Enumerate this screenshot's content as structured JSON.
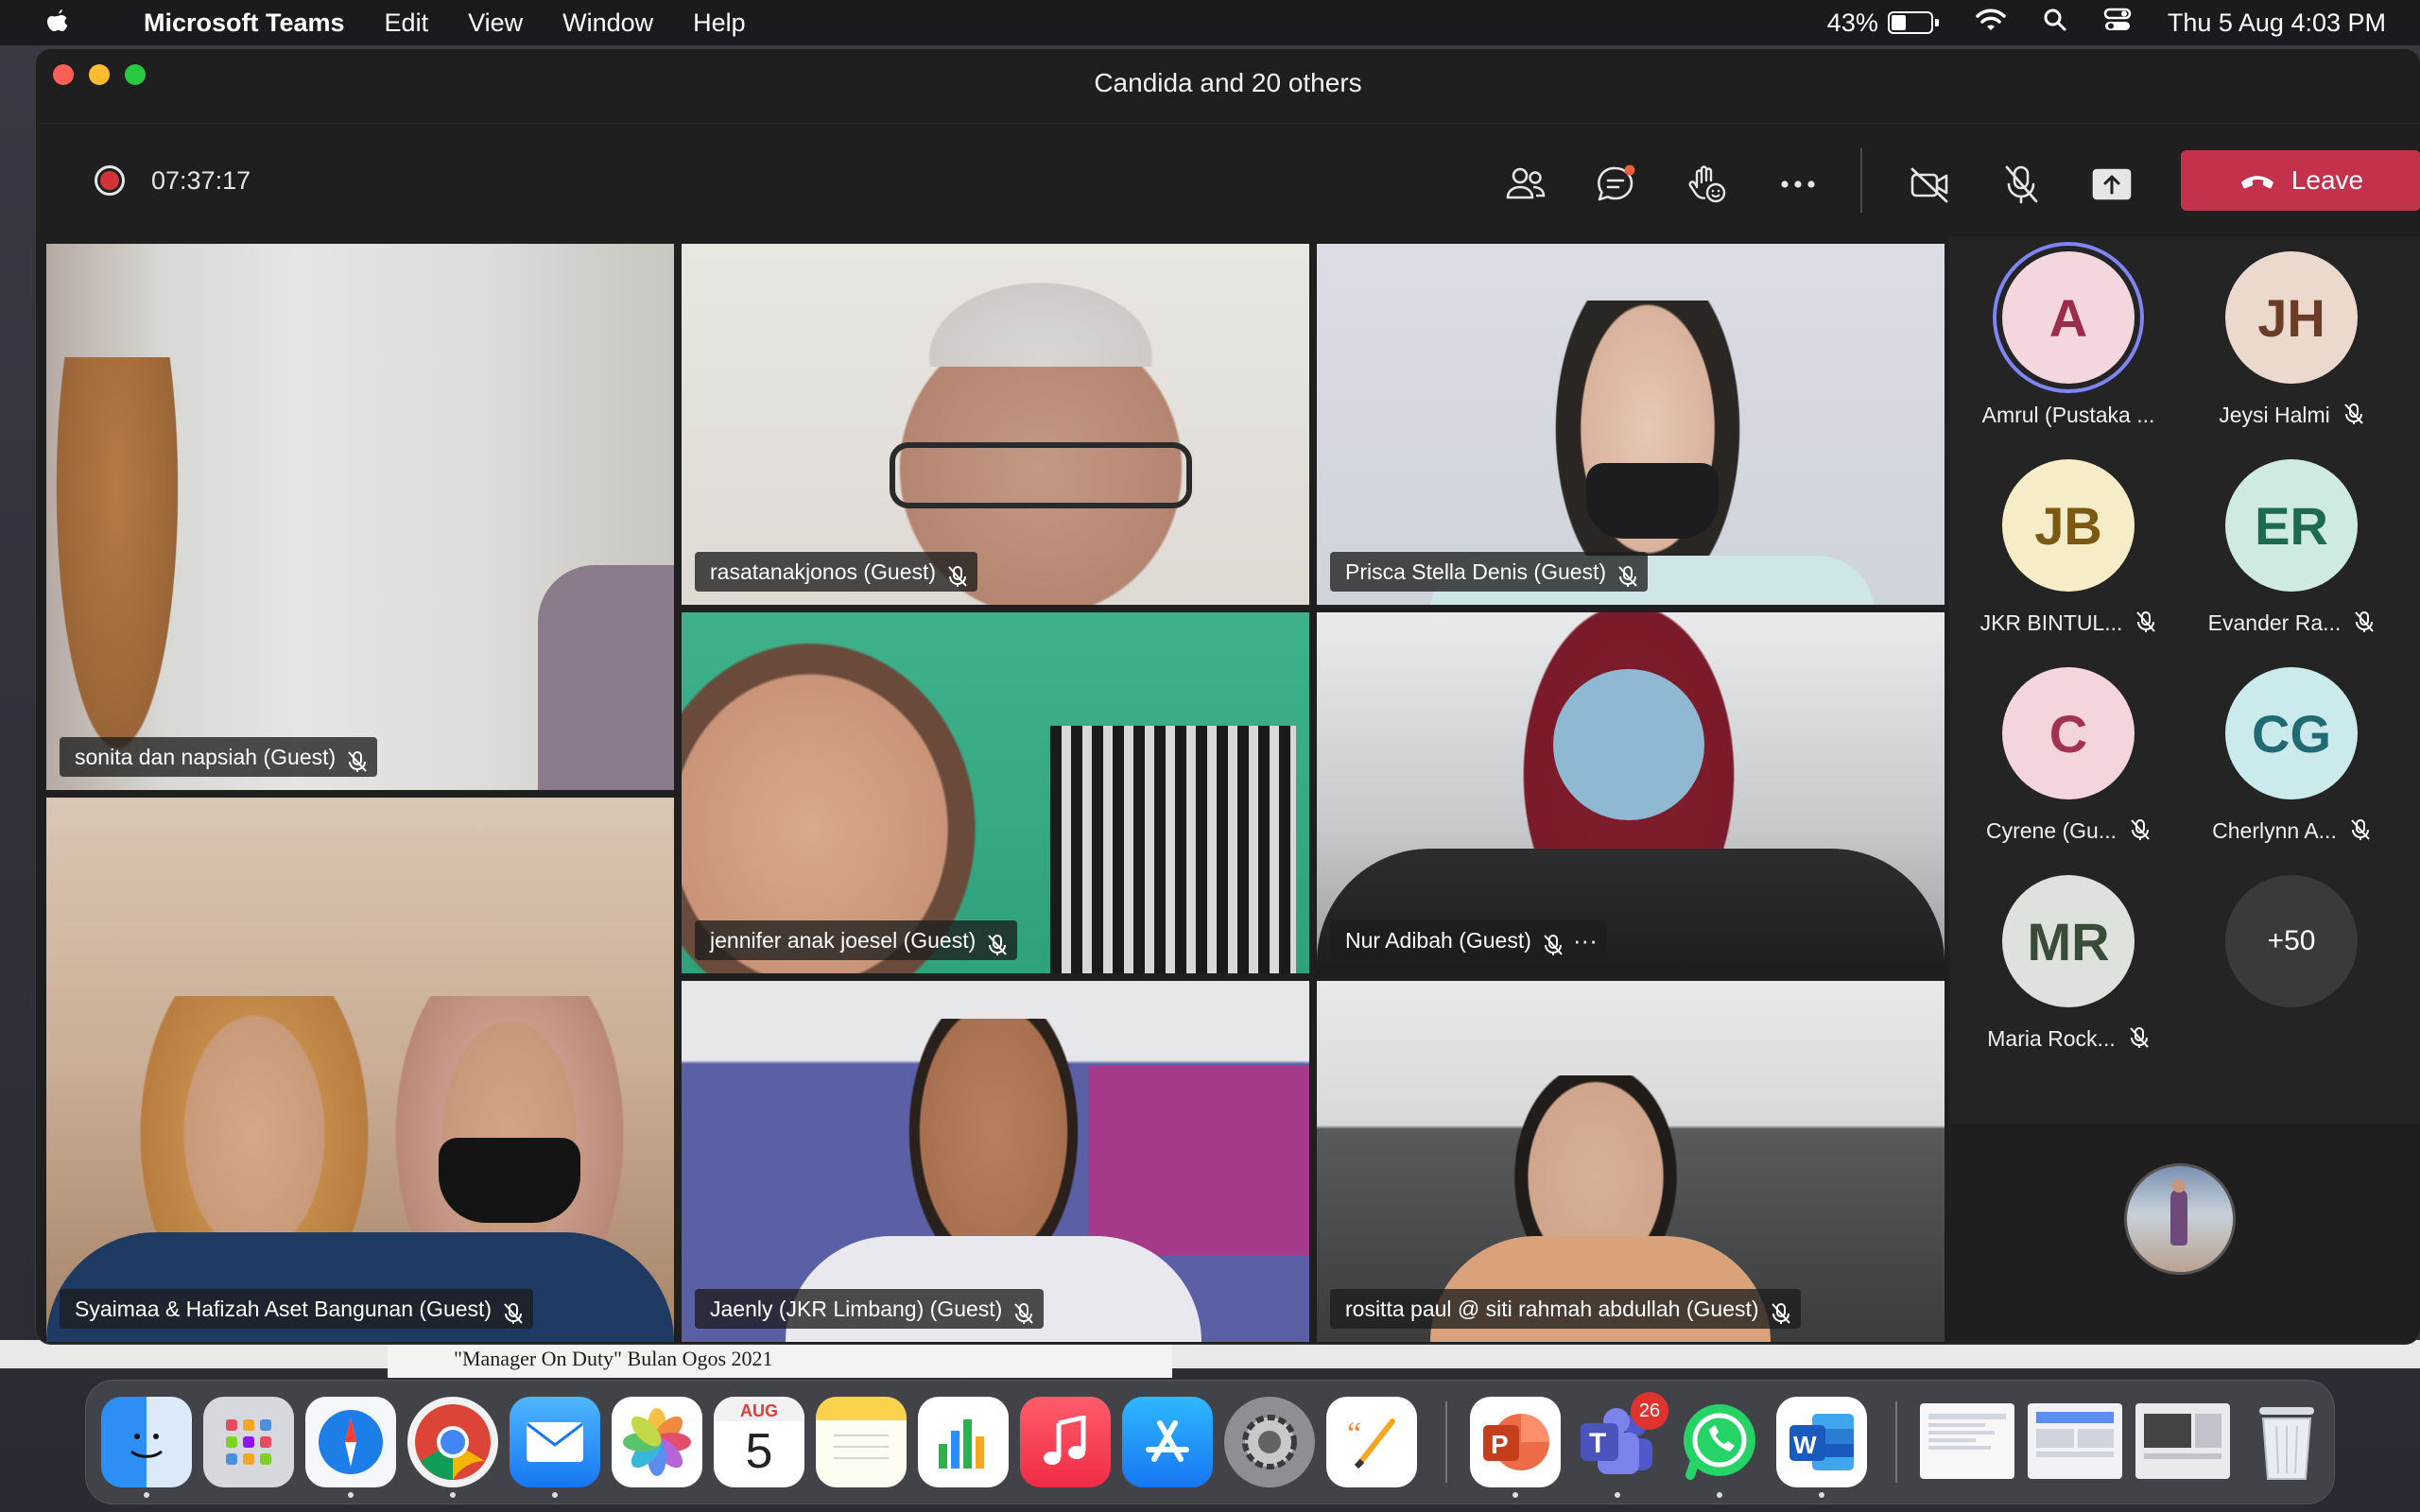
{
  "menubar": {
    "app_name": "Microsoft Teams",
    "items": [
      "Edit",
      "View",
      "Window",
      "Help"
    ],
    "battery": "43%",
    "battery_level": 0.43,
    "clock": "Thu 5 Aug  4:03 PM"
  },
  "window": {
    "title": "Candida and 20 others"
  },
  "toolbar": {
    "timer": "07:37:17",
    "leave_label": "Leave",
    "icons": [
      "people-icon",
      "chat-icon",
      "reactions-icon",
      "more-icon",
      "camera-off-icon",
      "mic-off-icon",
      "share-icon"
    ]
  },
  "tiles": [
    {
      "name": "sonita dan napsiah (Guest)"
    },
    {
      "name": "rasatanakjonos (Guest)"
    },
    {
      "name": "Prisca Stella Denis (Guest)"
    },
    {
      "name": "jennifer anak joesel (Guest)"
    },
    {
      "name": "Nur Adibah (Guest)"
    },
    {
      "name": "Syaimaa & Hafizah Aset Bangunan (Guest)"
    },
    {
      "name": "Jaenly (JKR Limbang) (Guest)"
    },
    {
      "name": "rositta paul @ siti rahmah abdullah (Guest)"
    }
  ],
  "roster": [
    {
      "initials": "A",
      "name": "Amrul (Pustaka ...",
      "bg": "#f3d6de",
      "fg": "#9b2c4a",
      "muted": false
    },
    {
      "initials": "JH",
      "name": "Jeysi Halmi",
      "bg": "#ecd9cd",
      "fg": "#6b3d28",
      "muted": true
    },
    {
      "initials": "JB",
      "name": "JKR BINTUL...",
      "bg": "#f6ecc7",
      "fg": "#7a5a12",
      "muted": true
    },
    {
      "initials": "ER",
      "name": "Evander Ra...",
      "bg": "#cfeadf",
      "fg": "#1d6b4e",
      "muted": true
    },
    {
      "initials": "C",
      "name": "Cyrene (Gu...",
      "bg": "#f4d5dc",
      "fg": "#a33250",
      "muted": true
    },
    {
      "initials": "CG",
      "name": "Cherlynn A...",
      "bg": "#cbeaec",
      "fg": "#1f6a73",
      "muted": true
    },
    {
      "initials": "MR",
      "name": "Maria Rock...",
      "bg": "#dde3dc",
      "fg": "#3b4b3a",
      "muted": true
    },
    {
      "initials": "+50",
      "name": "",
      "bg": "#3a3a3a",
      "fg": "#ffffff",
      "muted": false
    }
  ],
  "background_doc": {
    "text": "\"Manager On Duty\" Bulan Ogos 2021"
  },
  "dock": {
    "calendar_month": "AUG",
    "calendar_day": "5",
    "teams_badge": "26",
    "apps": [
      "finder-icon",
      "launchpad-icon",
      "safari-icon",
      "chrome-icon",
      "mail-icon",
      "photos-icon",
      "calendar-icon",
      "notes-icon",
      "numbers-icon",
      "music-icon",
      "app-store-icon",
      "system-preferences-icon",
      "pages-icon",
      "powerpoint-icon",
      "teams-icon",
      "whatsapp-icon",
      "word-icon",
      "trash-icon"
    ]
  }
}
